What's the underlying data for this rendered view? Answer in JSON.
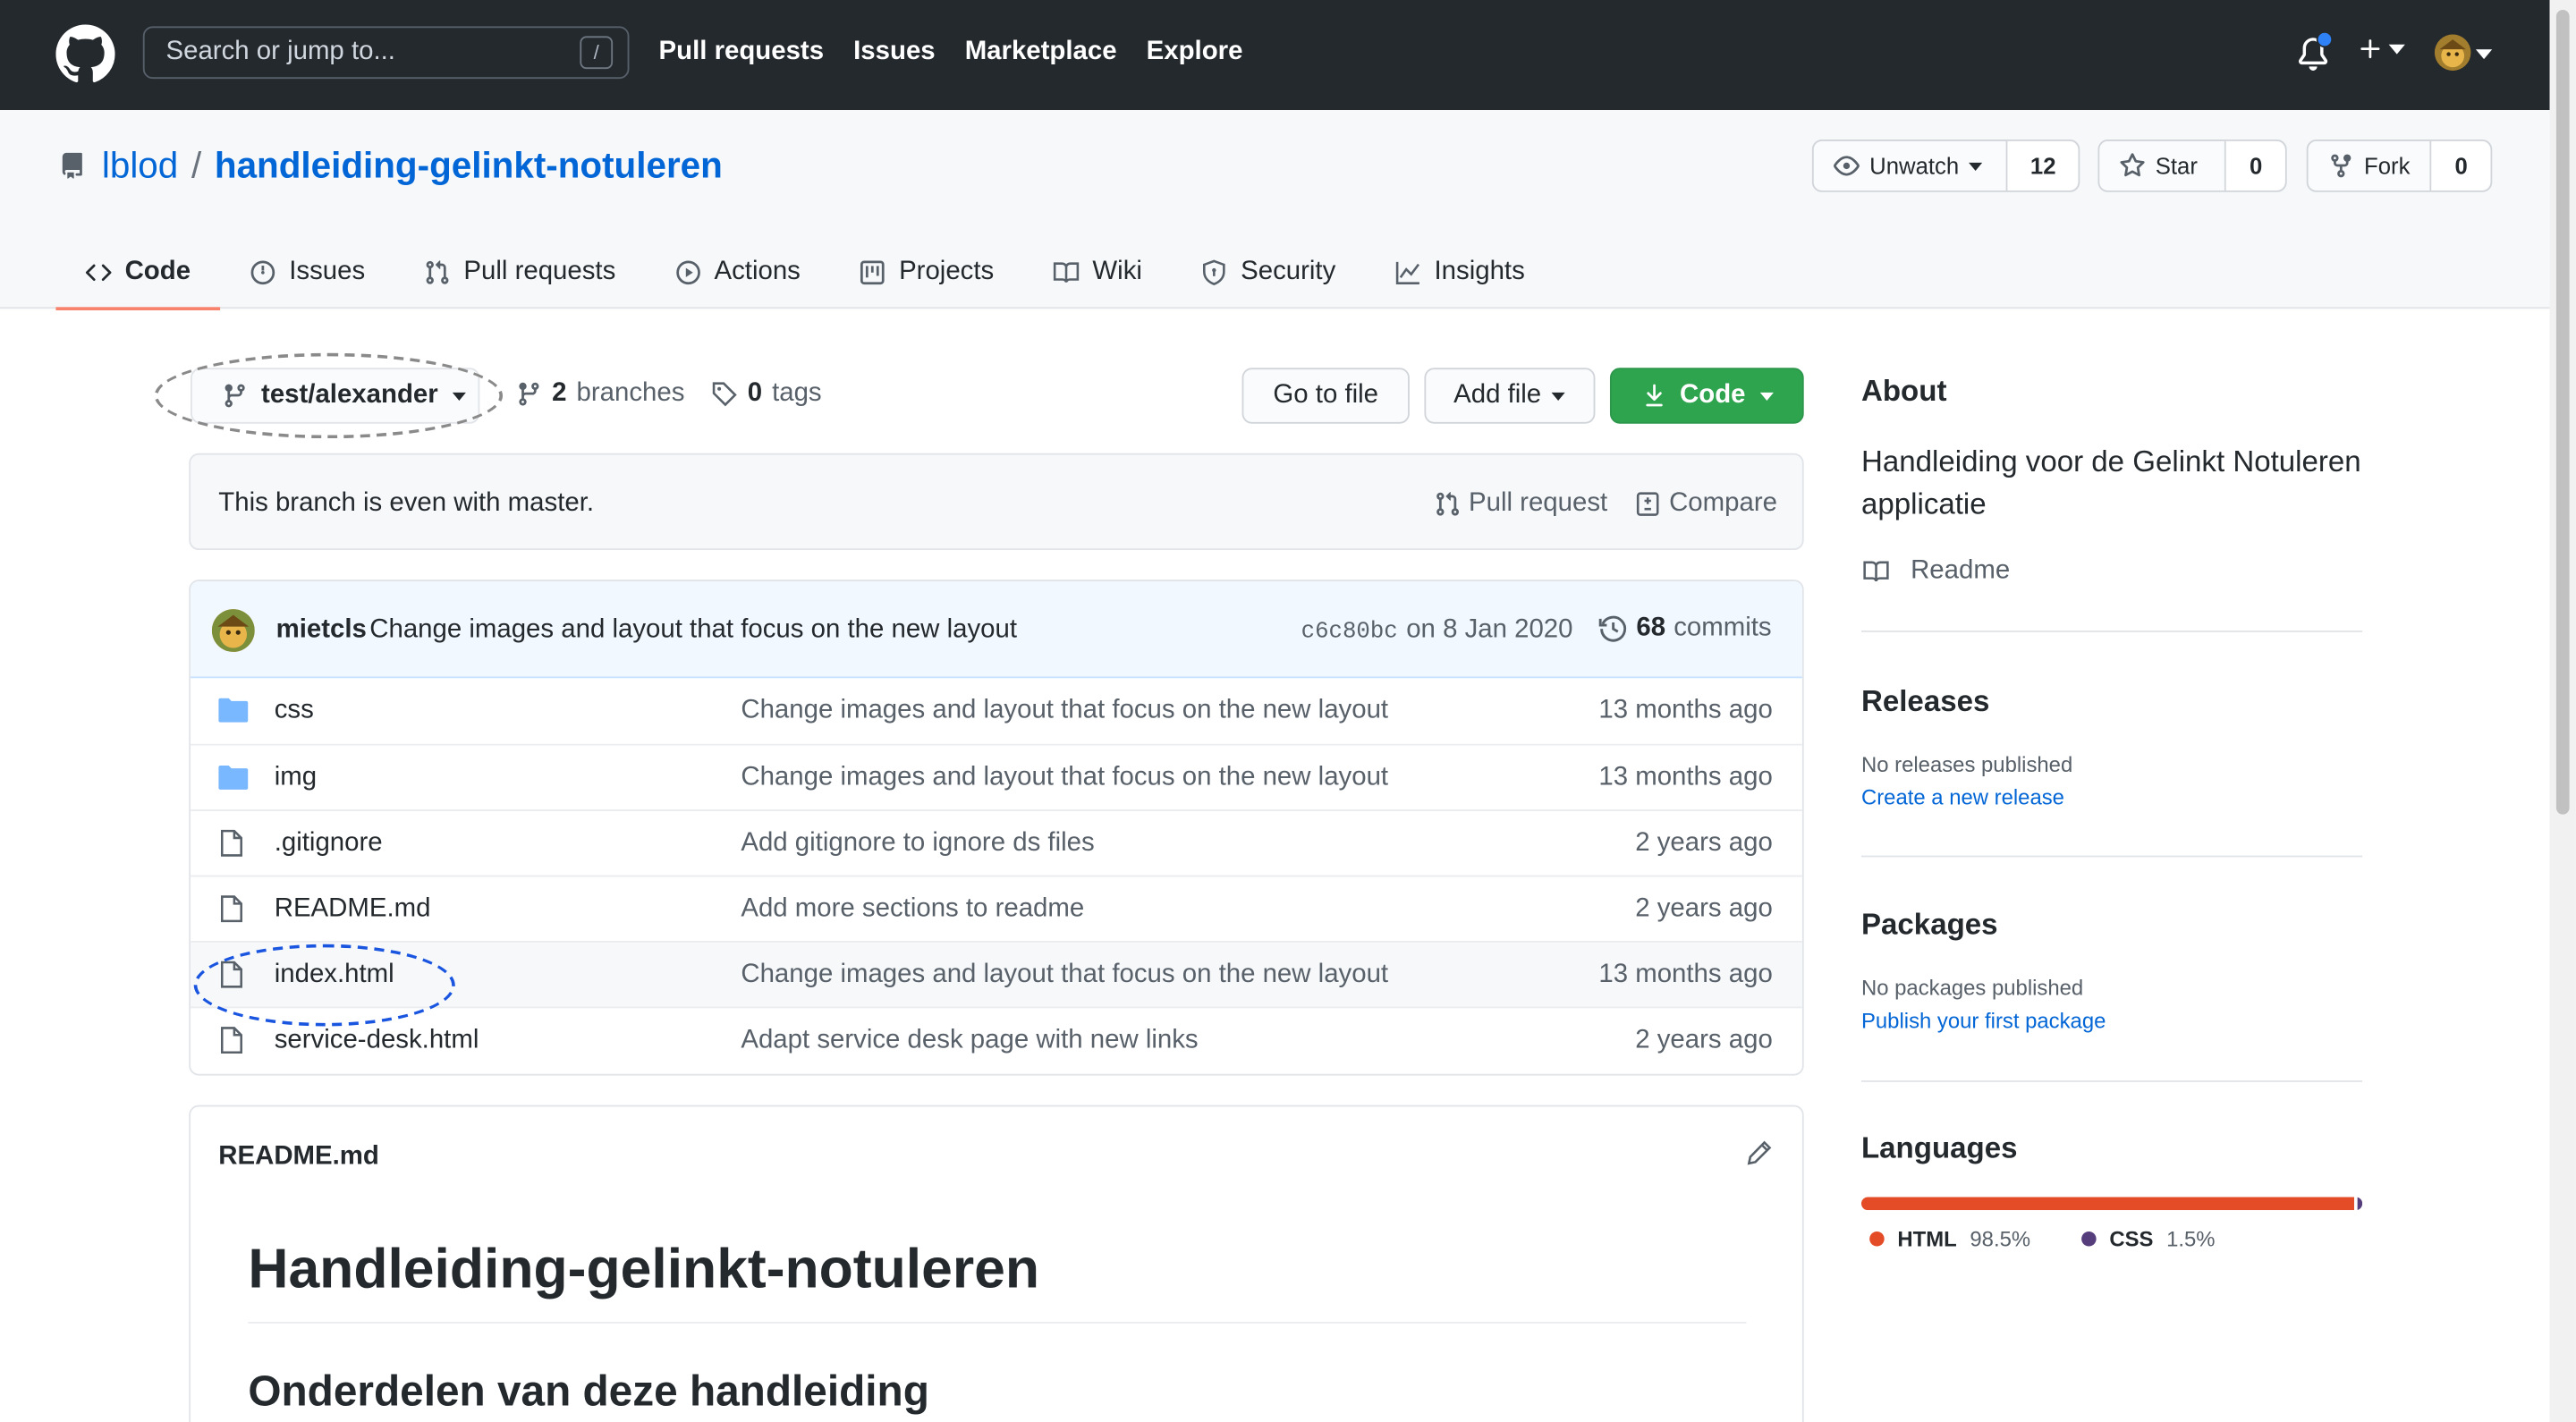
{
  "header": {
    "search_placeholder": "Search or jump to...",
    "search_shortcut": "/",
    "nav": [
      "Pull requests",
      "Issues",
      "Marketplace",
      "Explore"
    ]
  },
  "repo": {
    "owner": "lblod",
    "separator": "/",
    "name": "handleiding-gelinkt-notuleren",
    "watch": {
      "label": "Unwatch",
      "count": "12"
    },
    "star": {
      "label": "Star",
      "count": "0"
    },
    "fork": {
      "label": "Fork",
      "count": "0"
    }
  },
  "tabs": [
    {
      "label": "Code",
      "icon": "code-icon",
      "active": true
    },
    {
      "label": "Issues",
      "icon": "issue-icon"
    },
    {
      "label": "Pull requests",
      "icon": "pull-request-icon"
    },
    {
      "label": "Actions",
      "icon": "play-icon"
    },
    {
      "label": "Projects",
      "icon": "project-icon"
    },
    {
      "label": "Wiki",
      "icon": "book-icon"
    },
    {
      "label": "Security",
      "icon": "shield-icon"
    },
    {
      "label": "Insights",
      "icon": "graph-icon"
    }
  ],
  "toolbar": {
    "branch": "test/alexander",
    "branches_count": "2",
    "branches_label": "branches",
    "tags_count": "0",
    "tags_label": "tags",
    "go_to_file": "Go to file",
    "add_file": "Add file",
    "code": "Code"
  },
  "flash": {
    "message": "This branch is even with master.",
    "pull_request": "Pull request",
    "compare": "Compare"
  },
  "commit": {
    "author": "mietcls",
    "message": "Change images and layout that focus on the new layout",
    "sha": "c6c80bc",
    "date": "on 8 Jan 2020",
    "commits_count": "68",
    "commits_label": "commits"
  },
  "files": [
    {
      "type": "folder",
      "name": "css",
      "message": "Change images and layout that focus on the new layout",
      "age": "13 months ago"
    },
    {
      "type": "folder",
      "name": "img",
      "message": "Change images and layout that focus on the new layout",
      "age": "13 months ago"
    },
    {
      "type": "file",
      "name": ".gitignore",
      "message": "Add gitignore to ignore ds files",
      "age": "2 years ago"
    },
    {
      "type": "file",
      "name": "README.md",
      "message": "Add more sections to readme",
      "age": "2 years ago"
    },
    {
      "type": "file",
      "name": "index.html",
      "message": "Change images and layout that focus on the new layout",
      "age": "13 months ago"
    },
    {
      "type": "file",
      "name": "service-desk.html",
      "message": "Adapt service desk page with new links",
      "age": "2 years ago"
    }
  ],
  "readme": {
    "filename": "README.md",
    "h1": "Handleiding-gelinkt-notuleren",
    "h2": "Onderdelen van deze handleiding"
  },
  "sidebar": {
    "about_title": "About",
    "about_desc": "Handleiding voor de Gelinkt Notuleren applicatie",
    "readme_link": "Readme",
    "releases_title": "Releases",
    "releases_none": "No releases published",
    "releases_link": "Create a new release",
    "packages_title": "Packages",
    "packages_none": "No packages published",
    "packages_link": "Publish your first package",
    "languages_title": "Languages",
    "languages": [
      {
        "name": "HTML",
        "percent": "98.5%",
        "color": "#e34c26"
      },
      {
        "name": "CSS",
        "percent": "1.5%",
        "color": "#563d7c"
      }
    ]
  },
  "colors": {
    "header_bg": "#24292e",
    "link": "#0366d6",
    "green_button": "#2ea44f",
    "active_tab_underline": "#f9826c",
    "annotation_gray": "#888888",
    "annotation_blue": "#1a55e0"
  }
}
